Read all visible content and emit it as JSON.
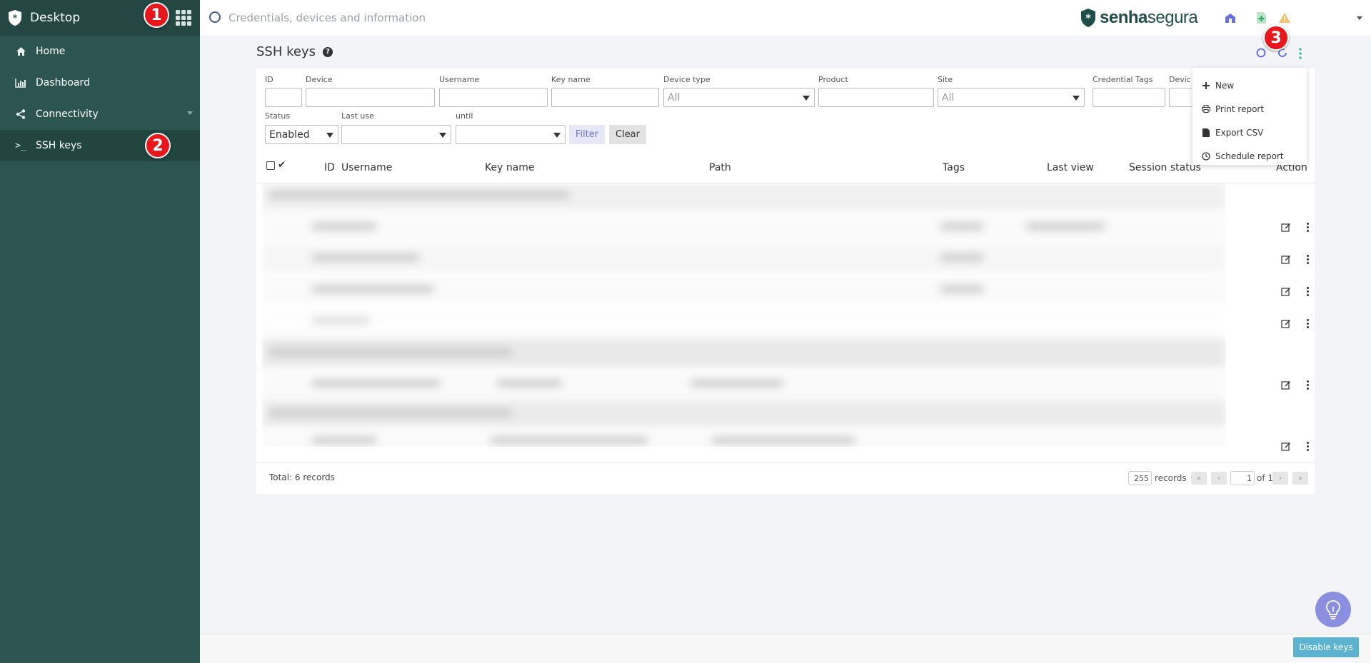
{
  "sidebar": {
    "title": "Desktop",
    "items": [
      {
        "label": "Home",
        "icon": "home-icon"
      },
      {
        "label": "Dashboard",
        "icon": "bar-chart-icon"
      },
      {
        "label": "Connectivity",
        "icon": "share-icon"
      },
      {
        "label": "SSH keys",
        "icon": "terminal-icon",
        "active": true
      }
    ]
  },
  "badges": [
    "1",
    "2",
    "3"
  ],
  "topbar": {
    "search_placeholder": "Credentials, devices and information",
    "brand_prefix": "senha",
    "brand_suffix": "segura"
  },
  "page": {
    "title": "SSH keys"
  },
  "filters": {
    "id_label": "ID",
    "device_label": "Device",
    "username_label": "Username",
    "keyname_label": "Key name",
    "devicetype_label": "Device type",
    "devicetype_value": "All",
    "product_label": "Product",
    "site_label": "Site",
    "site_value": "All",
    "credtags_label": "Credential Tags",
    "devicetags_label": "Devic",
    "status_label": "Status",
    "status_value": "Enabled",
    "lastuse_label": "Last use",
    "until_label": "until",
    "filter_button": "Filter",
    "clear_button": "Clear"
  },
  "table": {
    "columns": [
      "ID",
      "Username",
      "Key name",
      "Path",
      "Tags",
      "Last view",
      "Session status",
      "Action"
    ]
  },
  "footer": {
    "total": "Total: 6 records",
    "page_size": "255",
    "records_label": "records",
    "page": "1",
    "of_label": "of 1",
    "first": "«",
    "prev": "‹",
    "next": "›",
    "last": "»"
  },
  "menu": {
    "items": [
      {
        "label": "New",
        "icon": "plus-icon"
      },
      {
        "label": "Print report",
        "icon": "printer-icon"
      },
      {
        "label": "Export CSV",
        "icon": "file-icon"
      },
      {
        "label": "Schedule report",
        "icon": "clock-icon"
      }
    ]
  },
  "bottom": {
    "disable_button": "Disable keys"
  },
  "colors": {
    "sidebar": "#2c5450",
    "sidebar_header": "#244744",
    "brand": "#1f4e4a",
    "accent": "#5bb3d1",
    "badge": "#e8171b"
  }
}
